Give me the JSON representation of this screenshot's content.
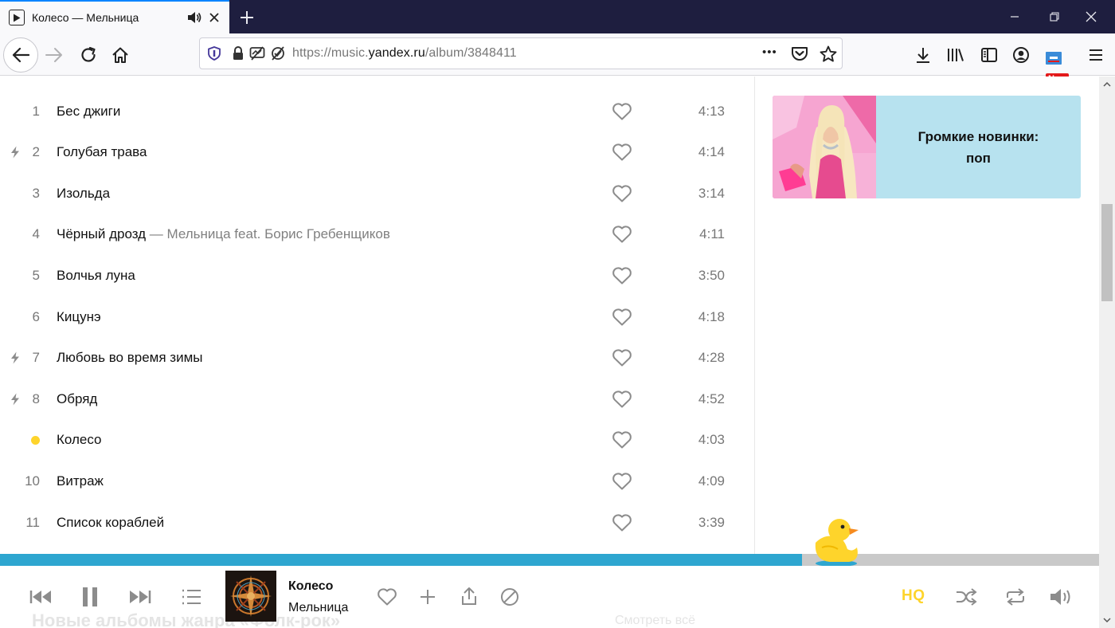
{
  "browser": {
    "tab_title": "Колесо — Мельница",
    "url_prefix": "https://music.",
    "url_domain": "yandex.ru",
    "url_path": "/album/3848411",
    "url_menu": "•••",
    "new_badge": "New"
  },
  "tracks": [
    {
      "num": "1",
      "name": "Бес джиги",
      "feat": "",
      "duration": "4:13",
      "flash": false,
      "playing": false
    },
    {
      "num": "2",
      "name": "Голубая трава",
      "feat": "",
      "duration": "4:14",
      "flash": true,
      "playing": false
    },
    {
      "num": "3",
      "name": "Изольда",
      "feat": "",
      "duration": "3:14",
      "flash": false,
      "playing": false
    },
    {
      "num": "4",
      "name": "Чёрный дрозд",
      "feat": " — Мельница feat. Борис Гребенщиков",
      "duration": "4:11",
      "flash": false,
      "playing": false
    },
    {
      "num": "5",
      "name": "Волчья луна",
      "feat": "",
      "duration": "3:50",
      "flash": false,
      "playing": false
    },
    {
      "num": "6",
      "name": "Кицунэ",
      "feat": "",
      "duration": "4:18",
      "flash": false,
      "playing": false
    },
    {
      "num": "7",
      "name": "Любовь во время зимы",
      "feat": "",
      "duration": "4:28",
      "flash": true,
      "playing": false
    },
    {
      "num": "8",
      "name": "Обряд",
      "feat": "",
      "duration": "4:52",
      "flash": true,
      "playing": false
    },
    {
      "num": "",
      "name": "Колесо",
      "feat": "",
      "duration": "4:03",
      "flash": false,
      "playing": true
    },
    {
      "num": "10",
      "name": "Витраж",
      "feat": "",
      "duration": "4:09",
      "flash": false,
      "playing": false
    },
    {
      "num": "11",
      "name": "Список кораблей",
      "feat": "",
      "duration": "3:39",
      "flash": false,
      "playing": false
    }
  ],
  "promo": {
    "line1": "Громкие новинки:",
    "line2": "поп"
  },
  "player": {
    "title": "Колесо",
    "artist": "Мельница",
    "quality": "HQ",
    "progress_fraction": 0.73,
    "under_heading": "Новые альбомы жанра «Фолк-рок»",
    "under_link": "Смотреть всё"
  },
  "colors": {
    "accent_yellow": "#fed42b",
    "progress_blue": "#2ea6d0",
    "promo_bg": "#b7e2ef"
  }
}
